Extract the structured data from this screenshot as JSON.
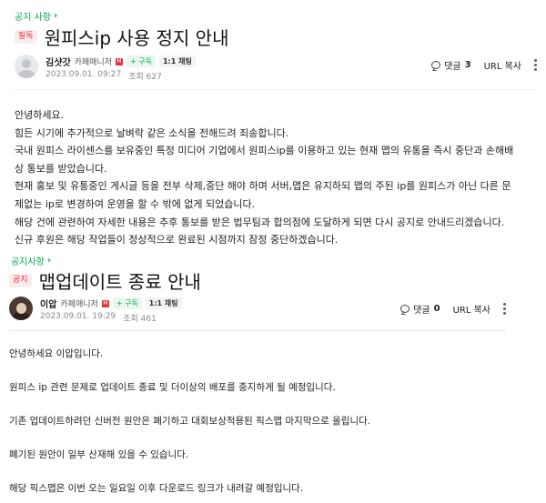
{
  "post1": {
    "category": "공지 사항",
    "badge": "필독",
    "title": "원피스ip 사용 정지 안내",
    "author": {
      "nickname": "김샷갓",
      "role": "카페매니저",
      "manager_mark": "M",
      "subscribe_label": "+ 구독",
      "chat_label": "1:1 채팅",
      "date": "2023.09.01. 09:27",
      "views": "조회 627"
    },
    "comment_label": "댓글",
    "comment_count": "3",
    "url_copy": "URL 복사",
    "body": [
      "안녕하세요.",
      "힘든 시기에 추가적으로 날벼락 같은 소식을 전해드려 죄송합니다.",
      "국내 원피스 라이센스를 보유중인 특정 미디어 기업에서 원피스ip를 이용하고 있는 현재 맵의 유통을 즉시 중단과 손해배",
      "상 통보를 받았습니다.",
      "현재 홍보 및 유통중인 게시글 등을 전부 삭제,중단 해야 하며 서버,맵은 유지하되 맵의 주된 ip를 원피스가 아닌 다른 문",
      "제없는 ip로 변경하여 운영을 할 수 밖에 없게 되었습니다.",
      "해당 건에 관련하여 자세한 내용은 추후 통보를 받은 법무팀과 합의점에 도달하게 되면 다시 공지로 안내드리겠습니다.",
      "신규 후원은 해당 작업들이 정상적으로 완료된 시점까지 잠정 중단하겠습니다."
    ]
  },
  "post2": {
    "category": "공지사항",
    "badge": "공지",
    "title": "맵업데이트 종료 안내",
    "author": {
      "nickname": "이압",
      "role": "카페매니저",
      "manager_mark": "M",
      "subscribe_label": "+ 구독",
      "chat_label": "1:1 채팅",
      "date": "2023.09.01. 19:29",
      "views": "조회 461"
    },
    "comment_label": "댓글",
    "comment_count": "0",
    "url_copy": "URL 복사",
    "body": [
      "안녕하세요 이압입니다.",
      "원피스 ip 관련 문제로  업데이트 종료 및 더이상의 배포를 중지하게 될 예정입니다.",
      "기존 업데이트하려던 신버전 원안은 폐기하고 대회보상적용된 픽스맵 마지막으로 올립니다.",
      "폐기된 원안이 일부 산재해 있을 수 있습니다.",
      "해당 픽스맵은 이번 오는 일요일 이후 다운로드 링크가 내려갈 예정입니다."
    ]
  },
  "colors": {
    "accent_green": "#03a94f",
    "badge_red": "#e4333d"
  }
}
